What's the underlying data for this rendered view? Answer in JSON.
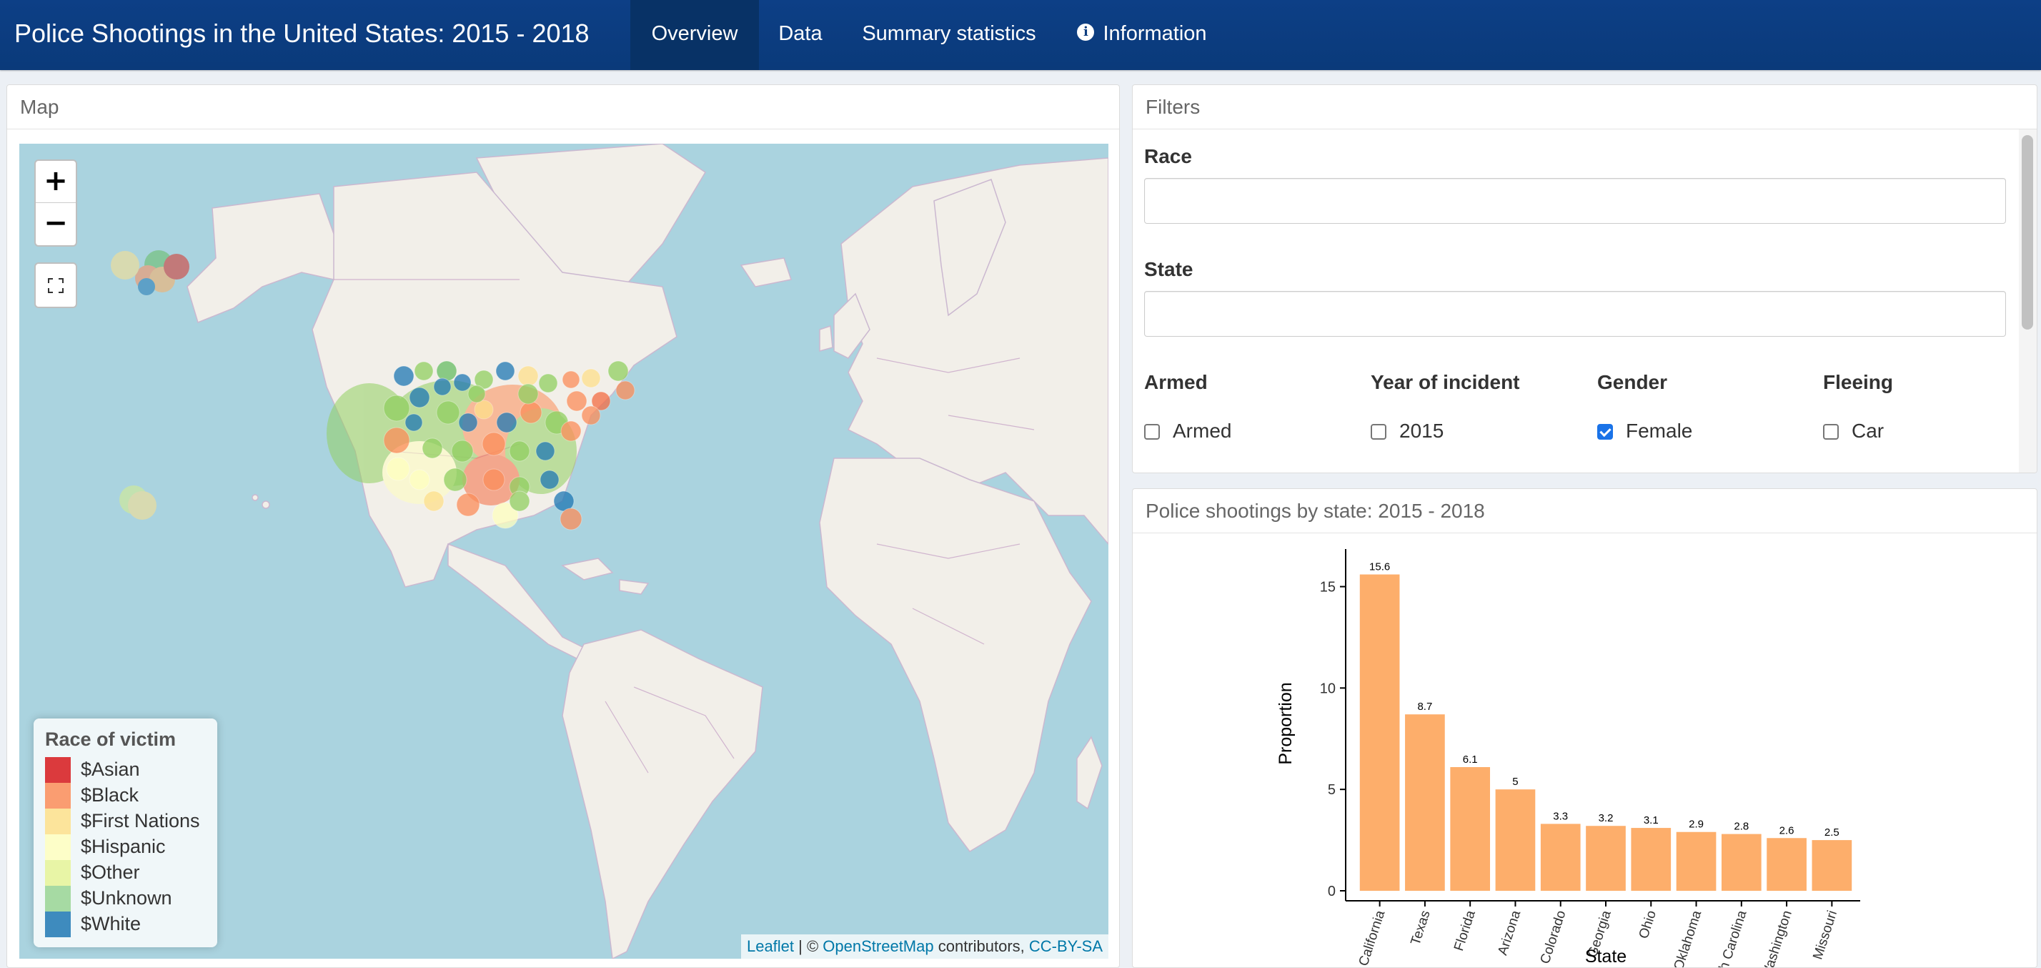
{
  "app": {
    "title": "Police Shootings in the United States: 2015 - 2018",
    "tabs": [
      {
        "label": "Overview",
        "active": true
      },
      {
        "label": "Data",
        "active": false
      },
      {
        "label": "Summary statistics",
        "active": false
      },
      {
        "label": "Information",
        "active": false,
        "icon": "info-circle-icon"
      }
    ]
  },
  "map_panel": {
    "header": "Map",
    "zoom_in": "+",
    "zoom_out": "−",
    "legend": {
      "title": "Race of victim",
      "items": [
        {
          "label": "$Asian",
          "color": "#d7191c"
        },
        {
          "label": "$Black",
          "color": "#fc8d59"
        },
        {
          "label": "$First Nations",
          "color": "#fee08b"
        },
        {
          "label": "$Hispanic",
          "color": "#ffffbf"
        },
        {
          "label": "$Other",
          "color": "#e6f598"
        },
        {
          "label": "$Unknown",
          "color": "#99d594"
        },
        {
          "label": "$White",
          "color": "#1f78b4"
        }
      ]
    },
    "attribution": {
      "leaflet": "Leaflet",
      "sep": " | © ",
      "osm": "OpenStreetMap",
      "contributors": " contributors, ",
      "license": "CC-BY-SA"
    }
  },
  "filters_panel": {
    "header": "Filters",
    "race_label": "Race",
    "race_value": "",
    "state_label": "State",
    "state_value": "",
    "groups": [
      {
        "label": "Armed",
        "option": "Armed",
        "checked": false
      },
      {
        "label": "Year of incident",
        "option": "2015",
        "checked": false
      },
      {
        "label": "Gender",
        "option": "Female",
        "checked": true
      },
      {
        "label": "Fleeing",
        "option": "Car",
        "checked": false
      }
    ]
  },
  "chart_panel": {
    "header": "Police shootings by state: 2015 - 2018"
  },
  "chart_data": {
    "type": "bar",
    "title": "",
    "xlabel": "State",
    "ylabel": "Proportion",
    "categories": [
      "California",
      "Texas",
      "Florida",
      "Arizona",
      "Colorado",
      "Georgia",
      "Ohio",
      "Oklahoma",
      "North Carolina",
      "Washington",
      "Missouri"
    ],
    "values": [
      15.6,
      8.7,
      6.1,
      5,
      3.3,
      3.2,
      3.1,
      2.9,
      2.8,
      2.6,
      2.5
    ],
    "value_labels": [
      "15.6",
      "8.7",
      "6.1",
      "5",
      "3.3",
      "3.2",
      "3.1",
      "2.9",
      "2.8",
      "2.6",
      "2.5"
    ],
    "yticks": [
      0,
      5,
      10,
      15
    ],
    "ylim": [
      0,
      16.5
    ],
    "bar_color": "#fdae6b",
    "grid": false
  }
}
